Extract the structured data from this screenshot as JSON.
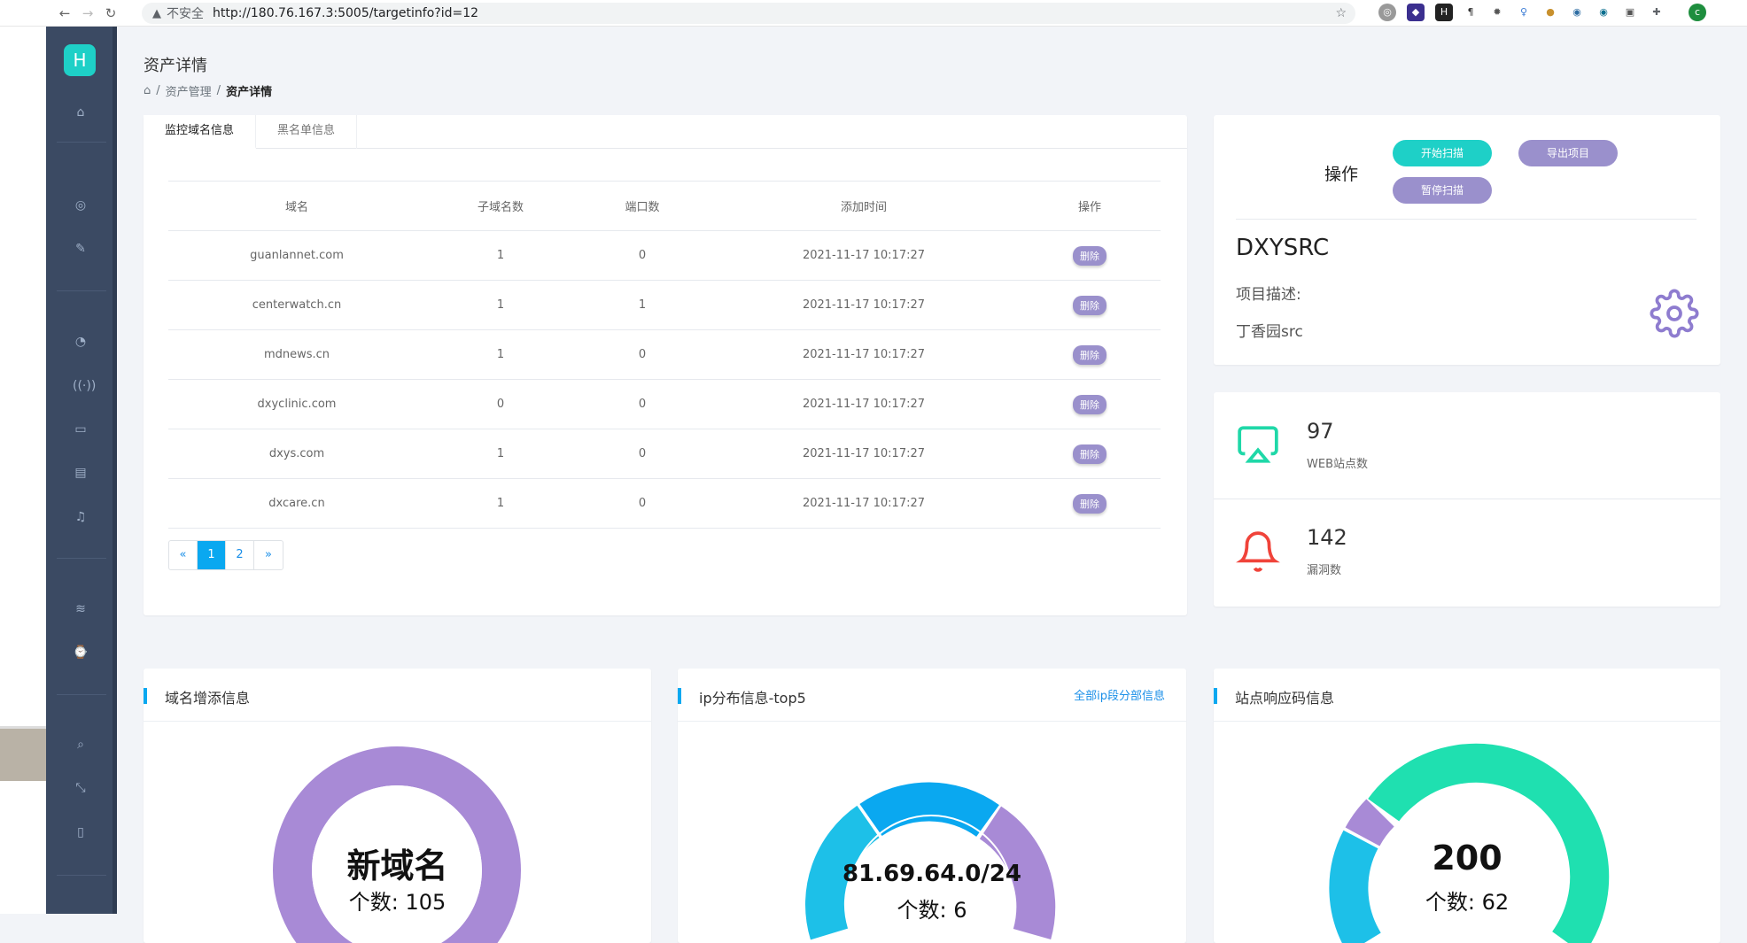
{
  "browser": {
    "insecure_label": "不安全",
    "url": "http://180.76.167.3:5005/targetinfo?id=12",
    "avatar_letter": "c"
  },
  "sidebar": {
    "logo_letter": "H"
  },
  "header": {
    "title": "资产详情",
    "breadcrumb": [
      "资产管理",
      "资产详情"
    ]
  },
  "tabs": [
    {
      "label": "监控域名信息",
      "active": true
    },
    {
      "label": "黑名单信息",
      "active": false
    }
  ],
  "table": {
    "headers": [
      "域名",
      "子域名数",
      "端口数",
      "添加时间",
      "操作"
    ],
    "delete_label": "删除",
    "rows": [
      {
        "domain": "guanlannet.com",
        "subdomains": "1",
        "ports": "0",
        "time": "2021-11-17 10:17:27"
      },
      {
        "domain": "centerwatch.cn",
        "subdomains": "1",
        "ports": "1",
        "time": "2021-11-17 10:17:27"
      },
      {
        "domain": "mdnews.cn",
        "subdomains": "1",
        "ports": "0",
        "time": "2021-11-17 10:17:27"
      },
      {
        "domain": "dxyclinic.com",
        "subdomains": "0",
        "ports": "0",
        "time": "2021-11-17 10:17:27"
      },
      {
        "domain": "dxys.com",
        "subdomains": "1",
        "ports": "0",
        "time": "2021-11-17 10:17:27"
      },
      {
        "domain": "dxcare.cn",
        "subdomains": "1",
        "ports": "0",
        "time": "2021-11-17 10:17:27"
      }
    ]
  },
  "pagination": {
    "prev": "«",
    "pages": [
      "1",
      "2"
    ],
    "current": "1",
    "next": "»"
  },
  "operations": {
    "label": "操作",
    "start_scan": "开始扫描",
    "export": "导出项目",
    "pause_scan": "暂停扫描"
  },
  "project": {
    "name": "DXYSRC",
    "desc_label": "项目描述:",
    "desc": "丁香园src"
  },
  "stats": {
    "web": {
      "value": "97",
      "label": "WEB站点数"
    },
    "vuln": {
      "value": "142",
      "label": "漏洞数"
    }
  },
  "bottom": {
    "domain_card": {
      "title": "域名增添信息",
      "center_title": "新域名",
      "center_count": "个数: 105"
    },
    "ip_card": {
      "title": "ip分布信息-top5",
      "link": "全部ip段分部信息",
      "center_title": "81.69.64.0/24",
      "center_count": "个数: 6"
    },
    "status_card": {
      "title": "站点响应码信息",
      "center_title": "200",
      "center_count": "个数: 62"
    }
  },
  "colors": {
    "accent": "#0aa8f0",
    "teal": "#1ed0c7",
    "purple": "#9a90cc",
    "sidebar": "#3b4a63",
    "danger": "#f0433a",
    "green": "#1fd8a8"
  }
}
